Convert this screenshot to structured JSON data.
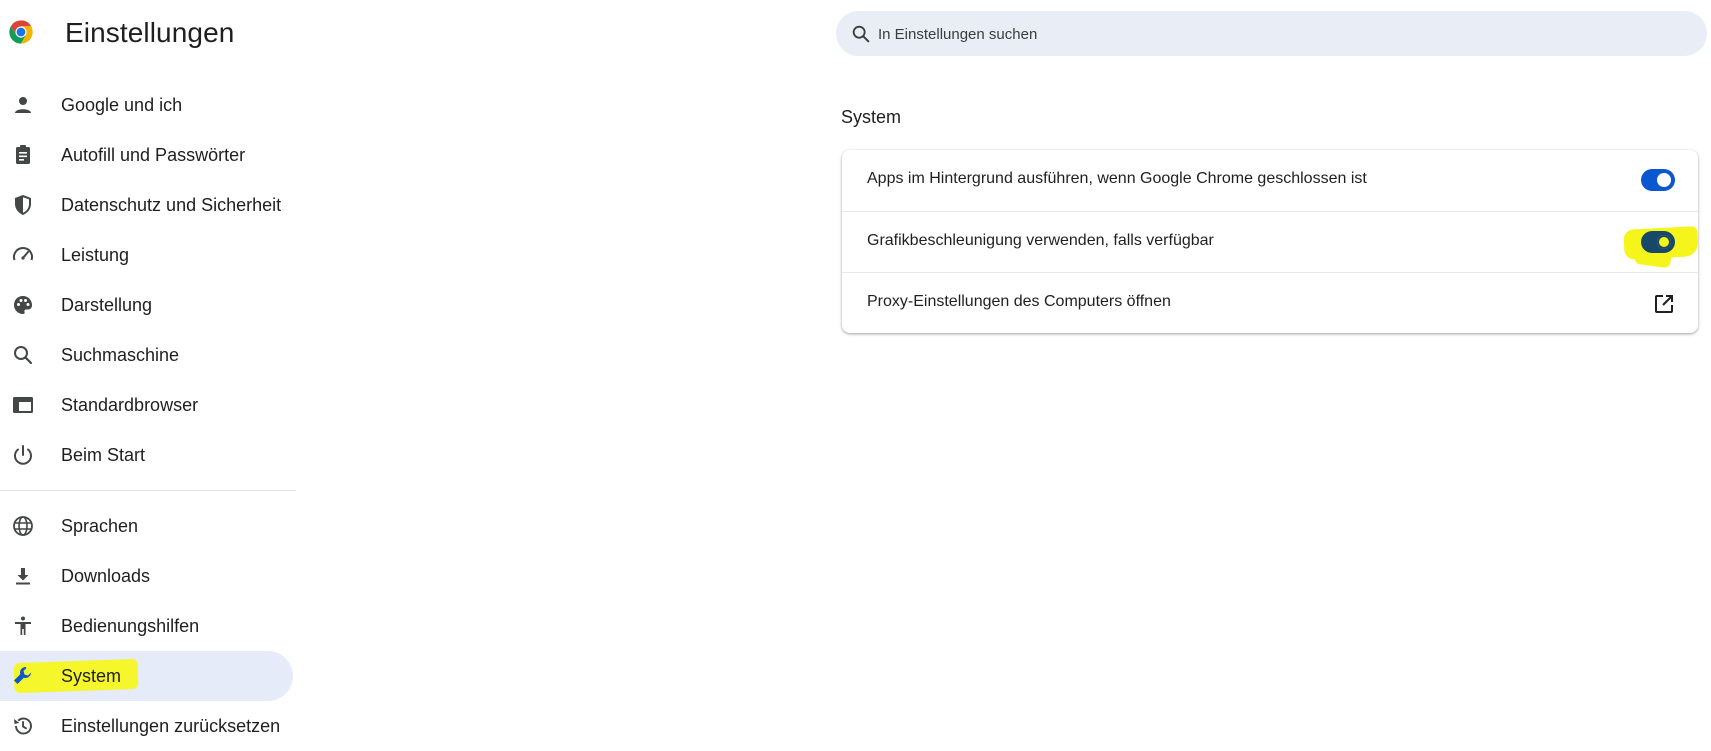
{
  "header": {
    "title": "Einstellungen",
    "search_placeholder": "In Einstellungen suchen",
    "search_value": ""
  },
  "sidebar": {
    "items": [
      {
        "label": "Google und ich",
        "icon": "person-icon"
      },
      {
        "label": "Autofill und Passwörter",
        "icon": "clipboard-icon"
      },
      {
        "label": "Datenschutz und Sicherheit",
        "icon": "shield-icon"
      },
      {
        "label": "Leistung",
        "icon": "speedometer-icon"
      },
      {
        "label": "Darstellung",
        "icon": "palette-icon"
      },
      {
        "label": "Suchmaschine",
        "icon": "search-icon"
      },
      {
        "label": "Standardbrowser",
        "icon": "browser-window-icon"
      },
      {
        "label": "Beim Start",
        "icon": "power-icon"
      },
      {
        "label": "Sprachen",
        "icon": "globe-icon"
      },
      {
        "label": "Downloads",
        "icon": "download-icon"
      },
      {
        "label": "Bedienungshilfen",
        "icon": "accessibility-icon"
      },
      {
        "label": "System",
        "icon": "wrench-icon",
        "active": true
      },
      {
        "label": "Einstellungen zurücksetzen",
        "icon": "history-icon"
      }
    ]
  },
  "main": {
    "section_title": "System",
    "settings": [
      {
        "label": "Apps im Hintergrund ausführen, wenn Google Chrome geschlossen ist",
        "control": "toggle",
        "state": "on"
      },
      {
        "label": "Grafikbeschleunigung verwenden, falls verfügbar",
        "control": "toggle",
        "state": "on"
      },
      {
        "label": "Proxy-Einstellungen des Computers öffnen",
        "control": "external-link-icon"
      }
    ]
  },
  "colors": {
    "accent": "#0b57d0",
    "active_nav_bg": "#e5ebf9",
    "search_bg": "#e9eef6",
    "highlight": "#f5f51c"
  }
}
